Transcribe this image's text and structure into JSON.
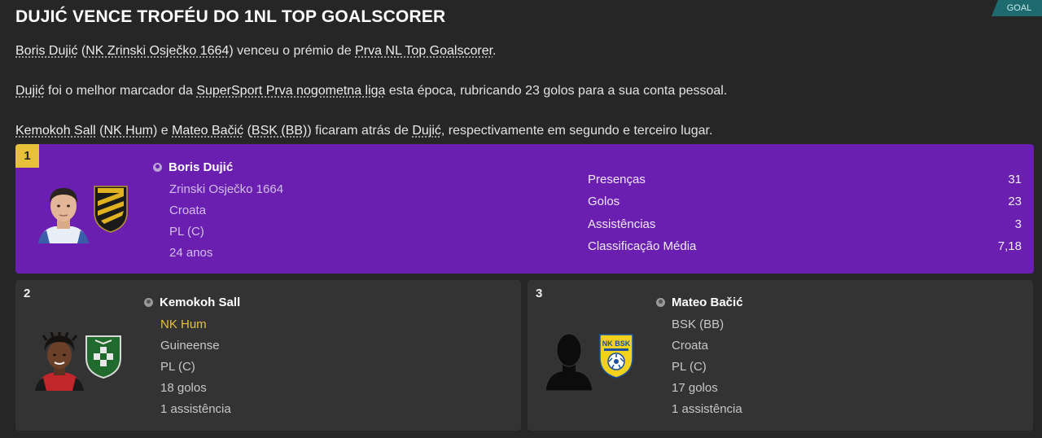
{
  "tag": "GOAL",
  "title": "DUJIĆ VENCE TROFÉU DO 1NL TOP GOALSCORER",
  "para1": {
    "player": "Boris Dujić",
    "open": " (",
    "club": "NK Zrinski Osječko 1664",
    "mid": ") venceu o prémio de ",
    "award": "Prva NL Top Goalscorer",
    "end": "."
  },
  "para2": {
    "player": "Dujić",
    "mid": " foi o melhor marcador da ",
    "league": "SuperSport Prva nogometna liga",
    "end": " esta época, rubricando 23 golos para a sua conta pessoal."
  },
  "para3": {
    "p2": "Kemokoh Sall",
    "open1": " (",
    "c2": "NK Hum",
    "mid1": ") e ",
    "p3": "Mateo Bačić",
    "open2": " (",
    "c3": "BSK (BB)",
    "mid2": ") ficaram atrás de ",
    "p1": "Dujić",
    "end": ", respectivamente em segundo e terceiro lugar."
  },
  "winner": {
    "rank": "1",
    "name": "Boris Dujić",
    "club": "Zrinski Osječko 1664",
    "nationality": "Croata",
    "position": "PL (C)",
    "age": "24 anos",
    "stats": [
      {
        "label": "Presenças",
        "value": "31"
      },
      {
        "label": "Golos",
        "value": "23"
      },
      {
        "label": "Assistências",
        "value": "3"
      },
      {
        "label": "Classificação Média",
        "value": "7,18"
      }
    ]
  },
  "second": {
    "rank": "2",
    "name": "Kemokoh Sall",
    "club": "NK Hum",
    "nationality": "Guineense",
    "position": "PL (C)",
    "goals": "18 golos",
    "assists": "1 assistência"
  },
  "third": {
    "rank": "3",
    "name": "Mateo Bačić",
    "club": "BSK (BB)",
    "nationality": "Croata",
    "position": "PL (C)",
    "goals": "17 golos",
    "assists": "1 assistência",
    "crest_text": "NK BSK"
  },
  "colors": {
    "background": "#262626",
    "winner_card": "#6a1fb0",
    "card": "#333333",
    "gold": "#e8c13a",
    "tag": "#1d6b6f"
  }
}
